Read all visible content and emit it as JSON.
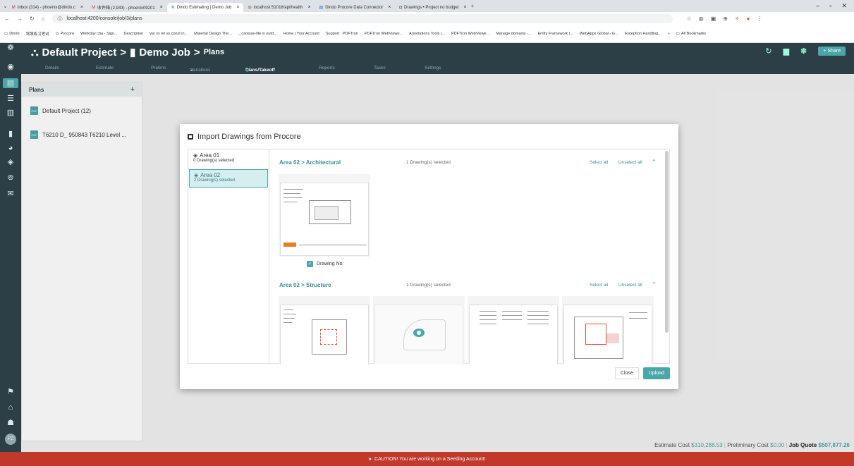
{
  "browser": {
    "tabs": [
      {
        "label": "Inbox (314) - phoenix@dindo.c",
        "icon": "gmail-icon",
        "active": false
      },
      {
        "label": "收件箱 (2,943) - phoenix09201",
        "icon": "gmail-icon",
        "active": false
      },
      {
        "label": "Dindo Estimating | Demo Job",
        "icon": "dindo-icon",
        "active": true
      },
      {
        "label": "localhost:51018/api/health",
        "icon": "globe-icon",
        "active": false
      },
      {
        "label": "Dindo Procore Data Connector",
        "icon": "doc-icon",
        "active": false
      },
      {
        "label": "Drawings • Project no budget",
        "icon": "procore-icon",
        "active": false
      }
    ],
    "url": "localhost:4200/console/job/3/plans",
    "bookmarks": [
      "Dindo",
      "驾照练习考试",
      "Procore",
      "Workday cba - Sign...",
      "Description",
      "var vs let vs const in...",
      "Material Design The...",
      "_.caniuse-lite is outd...",
      "Home | Your Account",
      "Support : PDFTron",
      "PDFTron WebViewe...",
      "Annotations Tools |...",
      "PDFTron WebViewe...",
      "Manage domains -...",
      "Entity Framework |...",
      "WebApps Global - G...",
      "Exception Handling...",
      "»",
      "All Bookmarks"
    ]
  },
  "header": {
    "project": "Default Project",
    "separator": ">",
    "job": "Demo Job",
    "page": "Plans",
    "share_label": "Share"
  },
  "subnav": [
    "Details",
    "Estimate",
    "Prelims",
    "Variations",
    "Plans/Takeoff",
    "Reports",
    "Tasks",
    "Settings"
  ],
  "plans_panel": {
    "title": "Plans",
    "add": "+",
    "items": [
      {
        "label": "Default Project (12)",
        "icon_text": "PDF"
      },
      {
        "label": "T6210 D_ 950843 T6210 Level ...",
        "icon_text": "PDF"
      }
    ]
  },
  "modal": {
    "title": "Import Drawings from Procore",
    "areas": [
      {
        "name": "Area 01",
        "count": "0 Drawing(s) selected",
        "selected": false
      },
      {
        "name": "Area 02",
        "count": "2 Drawing(s) selected",
        "selected": true
      }
    ],
    "sections": [
      {
        "path": "Area 02 > Architectural",
        "count": "1 Drawing(s) selected",
        "select_all": "Select all",
        "unselect_all": "Unselect all",
        "checkbox_label": "Drawing No:"
      },
      {
        "path": "Area 02 > Structure",
        "count": "1 Drawing(s) selected",
        "select_all": "Select all",
        "unselect_all": "Unselect all"
      }
    ],
    "close_label": "Close",
    "upload_label": "Upload"
  },
  "cost_bar": {
    "estimate_label": "Estimate Cost",
    "estimate_value": "$310,288.53",
    "prelim_label": "Preliminary Cost",
    "prelim_value": "$0.00",
    "quote_label": "Job Quote",
    "quote_value": "$507,877.26"
  },
  "caution": "CAUTION! You are working on a Seeding Account!",
  "colors": {
    "accent": "#4aa7a9",
    "dark": "#2c3f46",
    "caution": "#c0392b"
  }
}
